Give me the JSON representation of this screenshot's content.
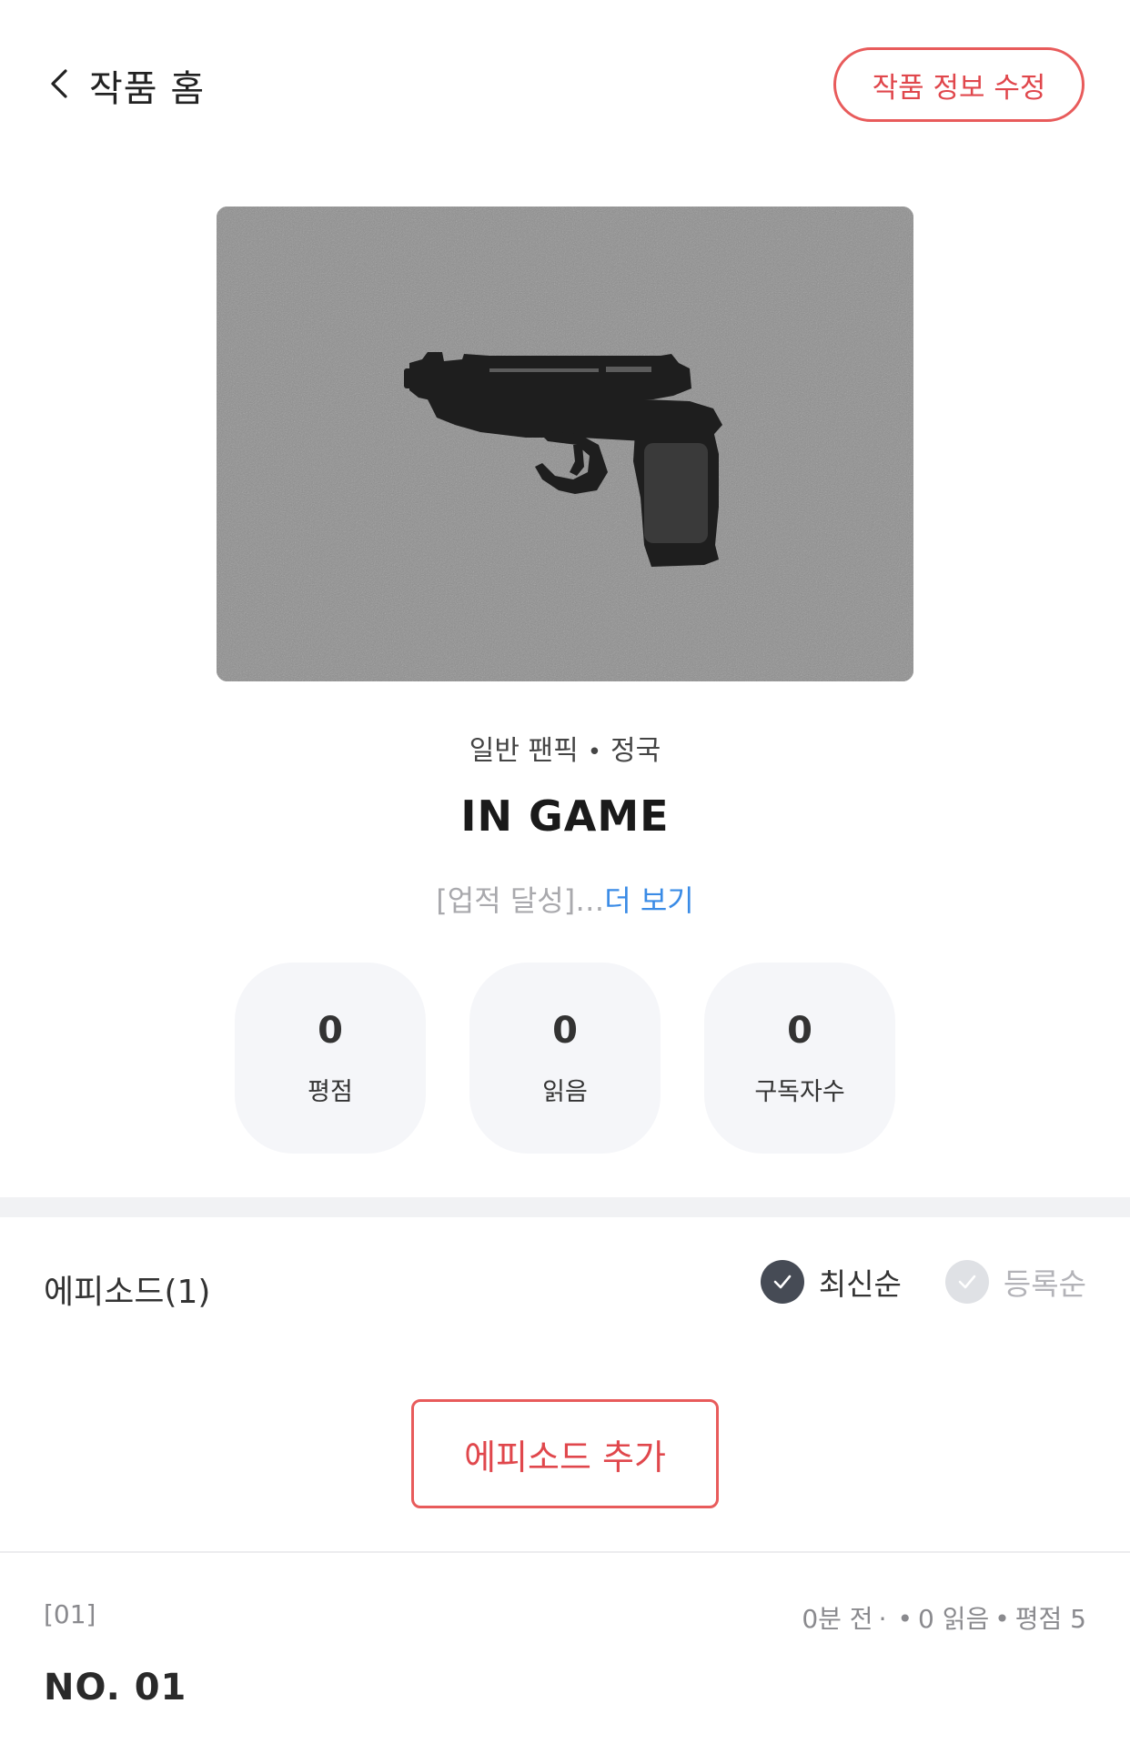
{
  "header": {
    "back_label": "작품 홈",
    "edit_label": "작품 정보 수정"
  },
  "work": {
    "category": "일반 팬픽",
    "character": "정국",
    "title": "IN GAME",
    "summary": "[업적 달성]…",
    "more_label": "더 보기",
    "cover_icon": "pistol-image"
  },
  "stats": [
    {
      "value": "0",
      "label": "평점"
    },
    {
      "value": "0",
      "label": "읽음"
    },
    {
      "value": "0",
      "label": "구독자수"
    }
  ],
  "episodes": {
    "header": "에피소드(1)",
    "sort_latest": "최신순",
    "sort_registered": "등록순",
    "add_label": "에피소드 추가",
    "items": [
      {
        "number": "[01]",
        "time": "0분 전",
        "reads": "0 읽음",
        "rating": "평점 5",
        "title": "NO. 01"
      }
    ]
  },
  "colors": {
    "accent": "#e0474c",
    "link": "#3a8be6"
  }
}
